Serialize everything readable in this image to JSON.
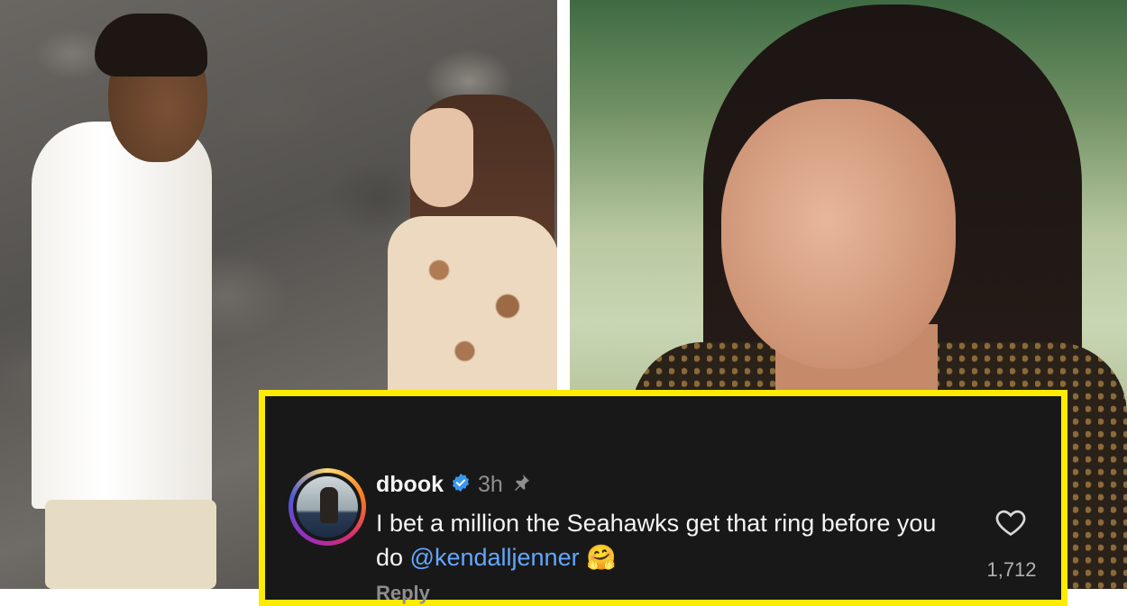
{
  "photos": {
    "left": {
      "subject": "couple on rocky beach"
    },
    "right": {
      "subject": "portrait at event"
    }
  },
  "comment": {
    "username": "dbook",
    "verified_icon": "verified-badge-icon",
    "time": "3h",
    "pin_icon": "pin-icon",
    "text_main": "I bet a million the Seahawks get that ring before you do ",
    "mention": "@kendalljenner",
    "emoji": "🤗",
    "like_icon": "heart-outline-icon",
    "like_count": "1,712",
    "reply_label": "Reply"
  },
  "colors": {
    "frame": "#ffeb00",
    "card_bg": "#181818",
    "mention": "#62a7ff"
  }
}
